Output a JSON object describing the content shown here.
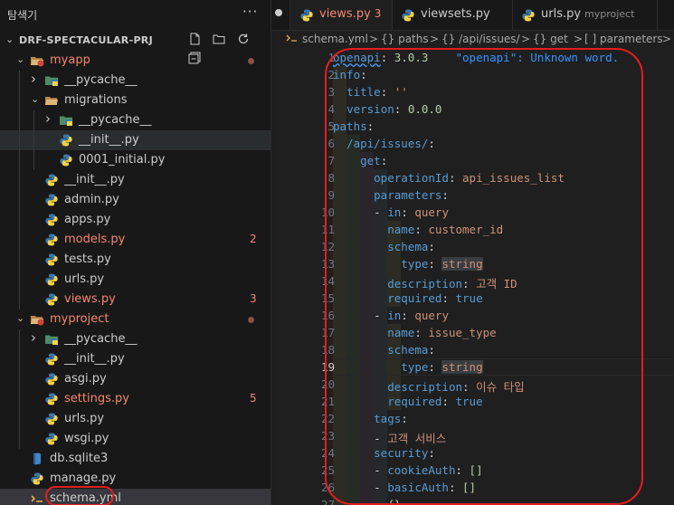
{
  "explorer": {
    "title": "탐색기",
    "more_label": "···",
    "project": "DRF-SPECTACULAR-PRJ",
    "actions": [
      "new-file-icon",
      "new-folder-icon",
      "refresh-icon",
      "collapse-all-icon"
    ]
  },
  "tree": [
    {
      "label": "myapp",
      "kind": "folder-open",
      "level": 1,
      "modified": true,
      "dot": true
    },
    {
      "label": "__pycache__",
      "kind": "folder-closed",
      "level": 2
    },
    {
      "label": "migrations",
      "kind": "folder-open-plain",
      "level": 2
    },
    {
      "label": "__pycache__",
      "kind": "folder-closed",
      "level": 3
    },
    {
      "label": "__init__.py",
      "kind": "py",
      "level": 3,
      "selected": true
    },
    {
      "label": "0001_initial.py",
      "kind": "py",
      "level": 3
    },
    {
      "label": "__init__.py",
      "kind": "py",
      "level": 2
    },
    {
      "label": "admin.py",
      "kind": "py",
      "level": 2
    },
    {
      "label": "apps.py",
      "kind": "py",
      "level": 2
    },
    {
      "label": "models.py",
      "kind": "py",
      "level": 2,
      "modified": true,
      "badge": "2"
    },
    {
      "label": "tests.py",
      "kind": "py",
      "level": 2
    },
    {
      "label": "urls.py",
      "kind": "py",
      "level": 2
    },
    {
      "label": "views.py",
      "kind": "py",
      "level": 2,
      "modified": true,
      "badge": "3"
    },
    {
      "label": "myproject",
      "kind": "folder-open",
      "level": 1,
      "modified": true,
      "dot": true
    },
    {
      "label": "__pycache__",
      "kind": "folder-closed",
      "level": 2
    },
    {
      "label": "__init__.py",
      "kind": "py",
      "level": 2
    },
    {
      "label": "asgi.py",
      "kind": "py",
      "level": 2
    },
    {
      "label": "settings.py",
      "kind": "py",
      "level": 2,
      "modified": true,
      "badge": "5"
    },
    {
      "label": "urls.py",
      "kind": "py",
      "level": 2
    },
    {
      "label": "wsgi.py",
      "kind": "py",
      "level": 2
    },
    {
      "label": "db.sqlite3",
      "kind": "db",
      "level": 1
    },
    {
      "label": "manage.py",
      "kind": "py",
      "level": 1
    },
    {
      "label": "schema.yml",
      "kind": "yml",
      "level": 1,
      "active": true
    }
  ],
  "tabs": [
    {
      "label": "views.py",
      "badge": "3",
      "active": true
    },
    {
      "label": "viewsets.py"
    },
    {
      "label": "urls.py",
      "sub": "myproject"
    }
  ],
  "breadcrumb": {
    "file": "schema.yml",
    "items": [
      "{} paths",
      "{} /api/issues/",
      "{} get",
      "[ ] parameters"
    ],
    "sep": ">"
  },
  "editor": {
    "current_line": 19,
    "lines": [
      {
        "n": 1,
        "html": "<span class=\"k sq\">openapi</span>: <span class=\"n\">3.0.3</span>    <span class=\"warn\">\"openapi\": Unknown word.</span>"
      },
      {
        "n": 2,
        "html": "<span class=\"k\">info</span>:"
      },
      {
        "n": 3,
        "html": "  <span class=\"k\">title</span>: <span class=\"v\">''</span>"
      },
      {
        "n": 4,
        "html": "  <span class=\"k\">version</span>: <span class=\"n\">0.0.0</span>"
      },
      {
        "n": 5,
        "html": "<span class=\"k\">paths</span>:"
      },
      {
        "n": 6,
        "html": "  <span class=\"k\">/api/issues/</span>:"
      },
      {
        "n": 7,
        "html": "    <span class=\"k\">get</span>:"
      },
      {
        "n": 8,
        "html": "      <span class=\"k\">operationId</span>: <span class=\"v\">api_issues_list</span>"
      },
      {
        "n": 9,
        "html": "      <span class=\"k\">parameters</span>:"
      },
      {
        "n": 10,
        "html": "      - <span class=\"k\">in</span>: <span class=\"v\">query</span>"
      },
      {
        "n": 11,
        "html": "        <span class=\"k\">name</span>: <span class=\"v\">customer_id</span>"
      },
      {
        "n": 12,
        "html": "        <span class=\"k\">schema</span>:"
      },
      {
        "n": 13,
        "html": "          <span class=\"k\">type</span>: <span class=\"v hl\">string</span>"
      },
      {
        "n": 14,
        "html": "        <span class=\"k\">description</span>: <span class=\"v\">고객 ID</span>"
      },
      {
        "n": 15,
        "html": "        <span class=\"k\">required</span>: <span class=\"k\">true</span>"
      },
      {
        "n": 16,
        "html": "      - <span class=\"k\">in</span>: <span class=\"v\">query</span>"
      },
      {
        "n": 17,
        "html": "        <span class=\"k\">name</span>: <span class=\"v\">issue_type</span>"
      },
      {
        "n": 18,
        "html": "        <span class=\"k\">schema</span>:"
      },
      {
        "n": 19,
        "html": "          <span class=\"k\">type</span>: <span class=\"v hl\">string</span>"
      },
      {
        "n": 20,
        "html": "        <span class=\"k\">description</span>: <span class=\"v\">이슈 타입</span>"
      },
      {
        "n": 21,
        "html": "        <span class=\"k\">required</span>: <span class=\"k\">true</span>"
      },
      {
        "n": 22,
        "html": "      <span class=\"k\">tags</span>:"
      },
      {
        "n": 23,
        "html": "      - <span class=\"v\">고객 서비스</span>"
      },
      {
        "n": 24,
        "html": "      <span class=\"k\">security</span>:"
      },
      {
        "n": 25,
        "html": "      - <span class=\"k\">cookieAuth</span>: <span class=\"n\">[]</span>"
      },
      {
        "n": 26,
        "html": "      - <span class=\"k\">basicAuth</span>: <span class=\"n\">[]</span>"
      },
      {
        "n": 27,
        "html": "      - <span class=\"n\">{}</span>"
      }
    ]
  },
  "colors": {
    "modified": "#f48771",
    "annotation": "#e51d1d",
    "keyword": "#569cd6",
    "string": "#ce9178"
  }
}
